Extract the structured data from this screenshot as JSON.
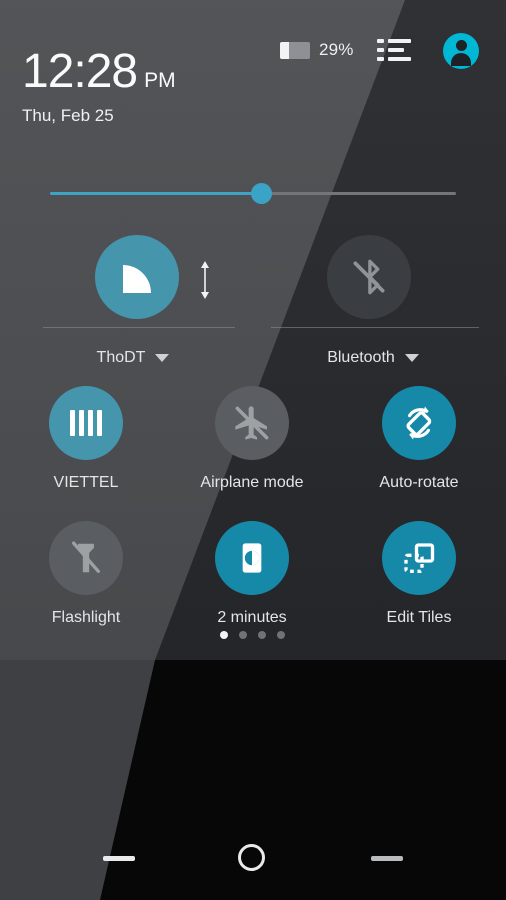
{
  "status": {
    "battery_percent": "29%",
    "battery_level": 29,
    "list_icon": "settings-list-icon",
    "avatar_icon": "user-avatar-icon"
  },
  "clock": {
    "time": "12:28",
    "meridiem": "PM",
    "date": "Thu, Feb 25"
  },
  "brightness": {
    "icon": "brightness-slider",
    "value": 52
  },
  "dual_tiles": [
    {
      "name": "wifi",
      "label": "ThoDT",
      "icon": "wifi-icon",
      "state": "on",
      "expandable": true,
      "has_detail_arrow": true
    },
    {
      "name": "bluetooth",
      "label": "Bluetooth",
      "icon": "bluetooth-disabled-icon",
      "state": "off",
      "expandable": true,
      "has_detail_arrow": false
    }
  ],
  "tiles": [
    {
      "name": "mobile-data",
      "label": "VIETTEL",
      "icon": "signal-bars-icon",
      "state": "on"
    },
    {
      "name": "airplane",
      "label": "Airplane mode",
      "icon": "airplane-off-icon",
      "state": "off"
    },
    {
      "name": "auto-rotate",
      "label": "Auto-rotate",
      "icon": "screen-rotate-icon",
      "state": "on"
    },
    {
      "name": "flashlight",
      "label": "Flashlight",
      "icon": "flashlight-off-icon",
      "state": "off"
    },
    {
      "name": "sleep",
      "label": "2 minutes",
      "icon": "screen-timeout-icon",
      "state": "on"
    },
    {
      "name": "edit-tiles",
      "label": "Edit Tiles",
      "icon": "edit-tiles-icon",
      "state": "on"
    }
  ],
  "pager": {
    "count": 4,
    "active": 1
  },
  "navbar": {
    "back": "back-button",
    "home": "home-button",
    "recents": "recents-button"
  },
  "colors": {
    "accent_light": "#4595ad",
    "accent_dark": "#1789a8",
    "avatar": "#00b8d4",
    "slider_fill": "#3fa3c4",
    "panel_light": "#4b4d50",
    "panel_dark": "#26282c"
  }
}
